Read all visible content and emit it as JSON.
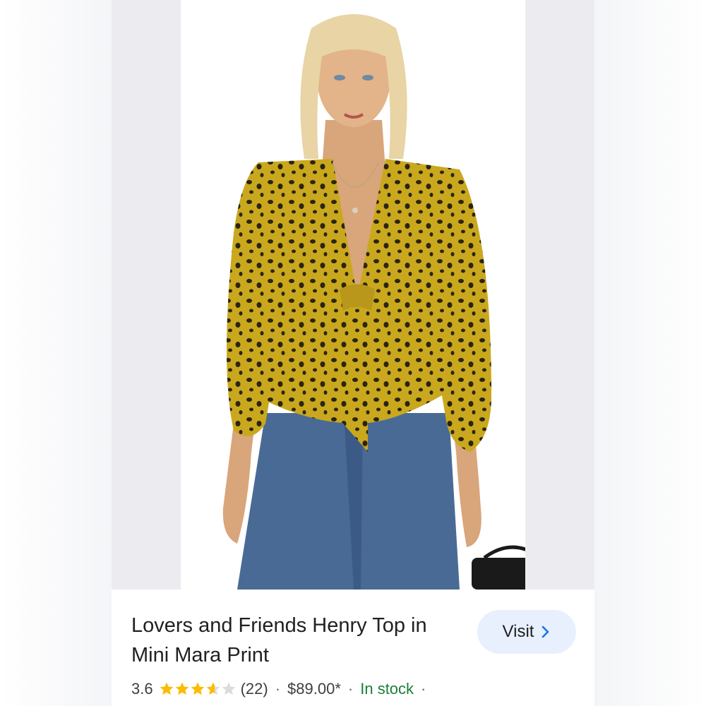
{
  "product": {
    "title": "Lovers and Friends Henry Top in Mini Mara Print",
    "rating_value": "3.6",
    "rating_fraction": 0.72,
    "star_count": 5,
    "review_count": "(22)",
    "price": "$89.00*",
    "availability": "In stock",
    "separator": "·"
  },
  "actions": {
    "visit_label": "Visit"
  },
  "colors": {
    "star_filled": "#fbbc04",
    "star_empty": "#dadce0",
    "availability": "#188038",
    "visit_bg": "#e8f0fe",
    "chevron": "#1a73e8"
  },
  "icons": {
    "visit_chevron": "chevron-right-icon",
    "rating_star": "star-icon"
  }
}
